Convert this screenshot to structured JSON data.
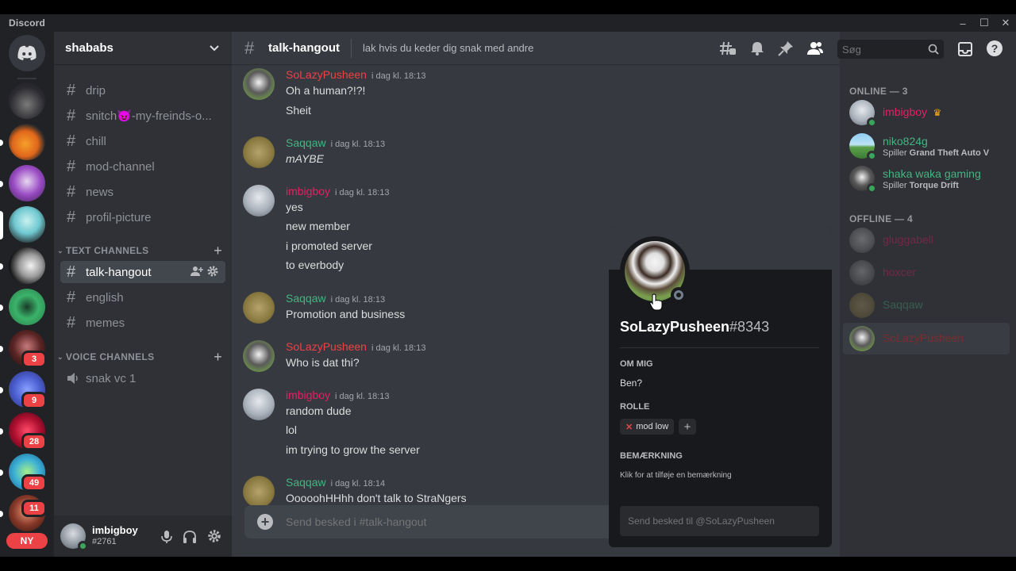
{
  "window": {
    "brand": "Discord",
    "controls": [
      "–",
      "☐",
      "✕"
    ]
  },
  "guilds": {
    "badges": [
      "3",
      "9",
      "28",
      "49",
      "11"
    ],
    "new_label": "NY"
  },
  "server": {
    "name": "shababs"
  },
  "channels_top": [
    {
      "name": "drip"
    },
    {
      "name": "snitch😈-my-freinds-o..."
    },
    {
      "name": "chill"
    },
    {
      "name": "mod-channel"
    },
    {
      "name": "news"
    },
    {
      "name": "profil-picture"
    }
  ],
  "categories": {
    "text": "TEXT CHANNELS",
    "voice": "VOICE CHANNELS"
  },
  "text_channels": [
    {
      "name": "talk-hangout"
    },
    {
      "name": "english"
    },
    {
      "name": "memes"
    }
  ],
  "voice_channels": [
    {
      "name": "snak vc 1"
    }
  ],
  "current_user": {
    "name": "imbigboy",
    "tag": "#2761"
  },
  "channel_header": {
    "name": "talk-hangout",
    "topic": "lak hvis du keder dig snak med andre",
    "search_placeholder": "Søg"
  },
  "messages": [
    {
      "author": "SoLazyPusheen",
      "color": "#ed4245",
      "time": "i dag kl. 18:13",
      "lines": [
        "Oh a human?!?!",
        "Sheit"
      ]
    },
    {
      "author": "Saqqaw",
      "color": "#43b581",
      "time": "i dag kl. 18:13",
      "lines": [
        "mAYBE"
      ]
    },
    {
      "author": "imbigboy",
      "color": "#e91e63",
      "time": "i dag kl. 18:13",
      "lines": [
        "yes",
        "new member",
        "i promoted server",
        "to everbody"
      ]
    },
    {
      "author": "Saqqaw",
      "color": "#43b581",
      "time": "i dag kl. 18:13",
      "lines": [
        "Promotion and business"
      ]
    },
    {
      "author": "SoLazyPusheen",
      "color": "#ed4245",
      "time": "i dag kl. 18:13",
      "lines": [
        "Who is dat thi?"
      ]
    },
    {
      "author": "imbigboy",
      "color": "#e91e63",
      "time": "i dag kl. 18:13",
      "lines": [
        "random dude",
        "lol",
        "im trying to grow the server"
      ]
    },
    {
      "author": "Saqqaw",
      "color": "#43b581",
      "time": "i dag kl. 18:14",
      "lines": [
        "OoooohHHhh don't talk to StraNgers"
      ]
    }
  ],
  "composer": {
    "placeholder": "Send besked i #talk-hangout"
  },
  "members": {
    "online_header": "ONLINE — 3",
    "offline_header": "OFFLINE — 4",
    "online": [
      {
        "name": "imbigboy",
        "color": "#e91e63",
        "activity_prefix": "",
        "activity": ""
      },
      {
        "name": "niko824g",
        "color": "#43b581",
        "activity_prefix": "Spiller",
        "activity": "Grand Theft Auto V"
      },
      {
        "name": "shaka waka gaming",
        "color": "#43b581",
        "activity_prefix": "Spiller",
        "activity": "Torque Drift"
      }
    ],
    "offline": [
      {
        "name": "gluggabell",
        "color": "#5e4a56"
      },
      {
        "name": "hoxcer",
        "color": "#5e4a56"
      },
      {
        "name": "Saqqaw",
        "color": "#3a6b55"
      },
      {
        "name": "SoLazyPusheen",
        "color": "#6b2b2d"
      }
    ]
  },
  "popout": {
    "username": "SoLazyPusheen",
    "discriminator": "#8343",
    "about_label": "OM MIG",
    "about_text": "Ben?",
    "roles_label": "ROLLE",
    "role_name": "mod low",
    "note_label": "BEMÆRKNING",
    "note_placeholder": "Klik for at tilføje en bemærkning",
    "dm_placeholder": "Send besked til @SoLazyPusheen"
  },
  "colors": {
    "online": "#3ba55c",
    "idle": "#faa81a",
    "offline": "#747f8d",
    "accent": "#5865f2"
  }
}
